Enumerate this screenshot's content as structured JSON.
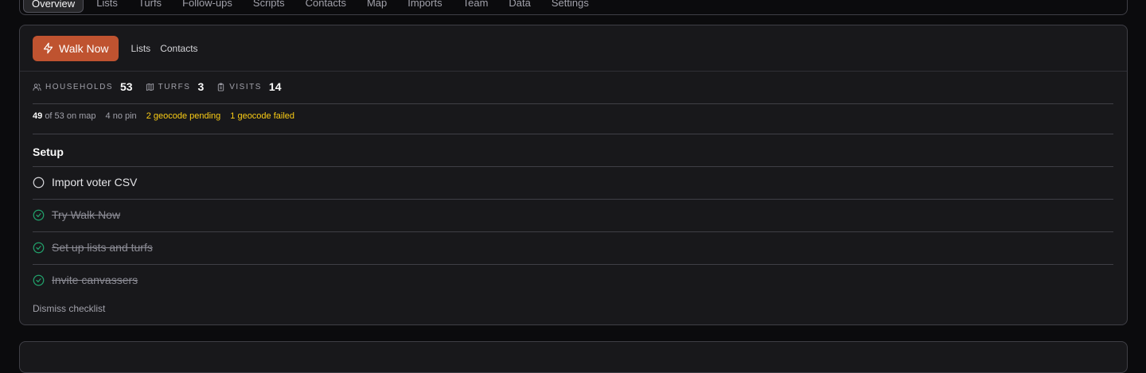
{
  "nav": {
    "tabs": [
      "Overview",
      "Lists",
      "Turfs",
      "Follow-ups",
      "Scripts",
      "Contacts",
      "Map",
      "Imports",
      "Team",
      "Data",
      "Settings"
    ],
    "active_tab": "Overview"
  },
  "header": {
    "walk_now_label": "Walk Now",
    "walk_now_icon": "lightning-icon",
    "links": [
      "Lists",
      "Contacts"
    ],
    "accent_color": "#bf5330"
  },
  "stats": {
    "households": {
      "label": "HOUSEHOLDS",
      "value": "53",
      "icon": "users-icon"
    },
    "turfs": {
      "label": "TURFS",
      "value": "3",
      "icon": "map-icon"
    },
    "visits": {
      "label": "VISITS",
      "value": "14",
      "icon": "clipboard-icon"
    }
  },
  "map_status": {
    "on_map_count": "49",
    "on_map_text": "of 53 on map",
    "no_pin": "4 no pin",
    "geocode_pending": "2 geocode pending",
    "geocode_failed": "1 geocode failed",
    "warning_color": "#facc15"
  },
  "setup": {
    "title": "Setup",
    "items": [
      {
        "label": "Import voter CSV",
        "done": false
      },
      {
        "label": "Try Walk Now",
        "done": true
      },
      {
        "label": "Set up lists and turfs",
        "done": true
      },
      {
        "label": "Invite canvassers",
        "done": true
      }
    ],
    "dismiss_label": "Dismiss checklist",
    "done_color": "#22c55e"
  }
}
